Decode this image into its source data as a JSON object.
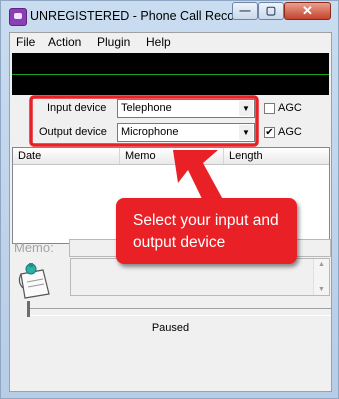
{
  "window": {
    "title": "UNREGISTERED - Phone Call Recor...",
    "minimize_glyph": "—",
    "maximize_glyph": "▢",
    "close_glyph": "✕"
  },
  "menu": [
    "File",
    "Action",
    "Plugin",
    "Help"
  ],
  "input_device": {
    "label": "Input device",
    "value": "Telephone",
    "agc_label": "AGC",
    "agc_checked": false
  },
  "output_device": {
    "label": "Output device",
    "value": "Microphone",
    "agc_label": "AGC",
    "agc_checked": true
  },
  "table": {
    "columns": [
      "Date",
      "Memo",
      "Length"
    ]
  },
  "memo": {
    "label": "Memo:"
  },
  "status": "Paused",
  "callout": {
    "text": "Select your input and output device",
    "color": "#e92127"
  },
  "icons": {
    "app": "phone-recorder-icon",
    "notes": "notepad-pin-icon",
    "dropdown": "chevron-down-icon",
    "checkbox": "checkmark-icon"
  }
}
